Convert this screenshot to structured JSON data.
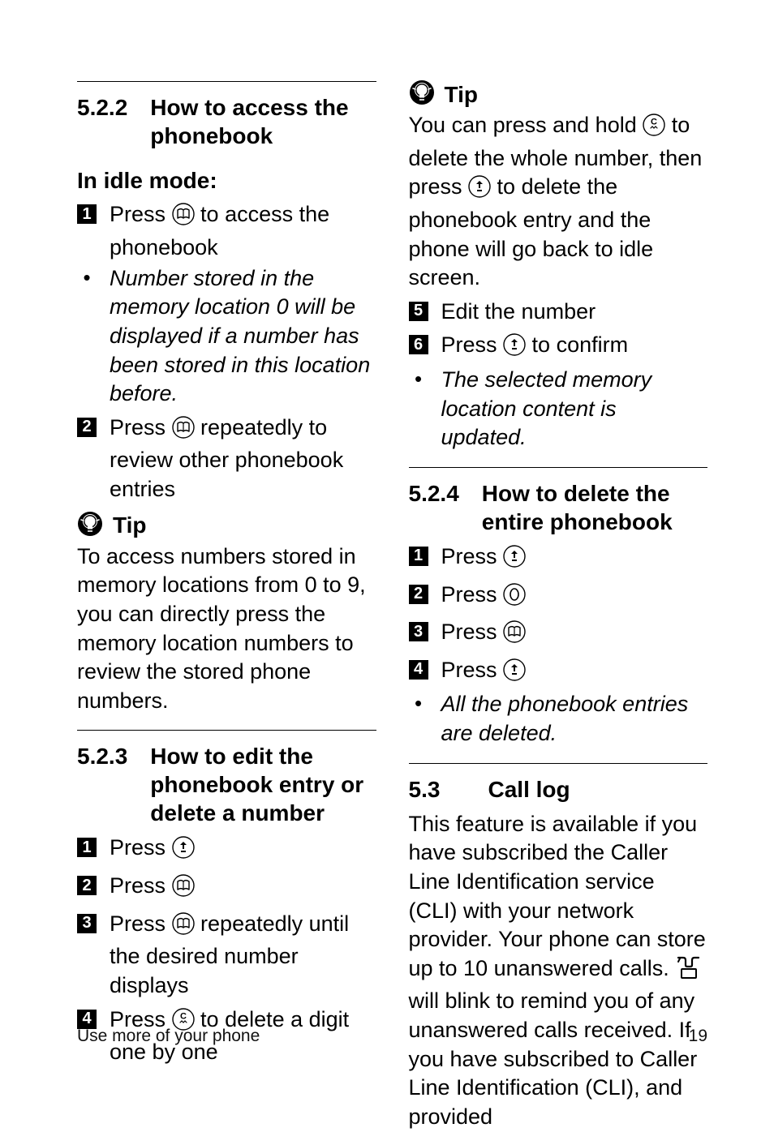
{
  "left": {
    "h522_num": "5.2.2",
    "h522_title": "How to access the phonebook",
    "sub_idle": "In idle mode:",
    "s1_pre": "Press ",
    "s1_post": " to access the phonebook",
    "bullet1": "Number stored in the memory location 0 will be displayed if a number has been stored in this location before.",
    "s2_pre": "Press ",
    "s2_post": " repeatedly to review other phonebook entries",
    "tip_label": "Tip",
    "tip1_body": "To access numbers stored in memory locations from 0 to 9, you can directly press the memory location numbers to review the stored phone numbers.",
    "h523_num": "5.2.3",
    "h523_title": "How to edit the phonebook entry or delete a number",
    "s523_1": "Press ",
    "s523_2": "Press ",
    "s523_3_pre": "Press ",
    "s523_3_post": " repeatedly until the desired number displays",
    "s523_4_pre": "Press ",
    "s523_4_post": " to delete a digit one by one"
  },
  "right": {
    "tip_label": "Tip",
    "tip2_a": "You can press and hold ",
    "tip2_b": " to delete the whole number, then press ",
    "tip2_c": " to delete the phonebook entry and the phone will go back to idle screen.",
    "s5": "Edit the number",
    "s6_pre": "Press ",
    "s6_post": " to confirm",
    "bullet2": "The selected memory location content is updated.",
    "h524_num": "5.2.4",
    "h524_title": "How to delete the entire phonebook",
    "s524_1": "Press ",
    "s524_2": "Press ",
    "s524_3": "Press ",
    "s524_4": "Press ",
    "bullet3": "All the phonebook entries are deleted.",
    "h53_num": "5.3",
    "h53_title": "Call log",
    "p53_a": "This feature is available if you have subscribed the Caller Line Identification service (CLI) with your network provider. Your phone can store up to 10 unanswered calls. ",
    "p53_b": " will blink to remind you of any unanswered calls received. If you have subscribed to Caller Line Identification (CLI), and provided"
  },
  "footer": {
    "left": "Use more of your phone",
    "right": "19"
  }
}
